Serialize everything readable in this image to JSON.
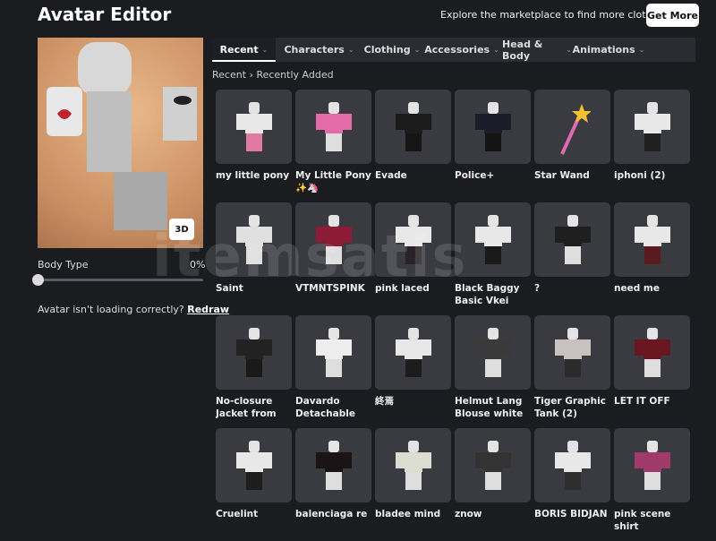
{
  "header": {
    "title": "Avatar Editor",
    "promo": "Explore the marketplace to find more clothes!",
    "get_more": "Get More"
  },
  "avatar": {
    "view_toggle": "3D",
    "body_type_label": "Body Type",
    "body_type_value": "0%",
    "body_type_fraction": 0,
    "loading_text": "Avatar isn't loading correctly?",
    "redraw": "Redraw"
  },
  "tabs": [
    {
      "label": "Recent",
      "active": true
    },
    {
      "label": "Characters"
    },
    {
      "label": "Clothing"
    },
    {
      "label": "Accessories"
    },
    {
      "label": "Head & Body"
    },
    {
      "label": "Animations"
    }
  ],
  "breadcrumb": {
    "root": "Recent",
    "sep": "›",
    "current": "Recently Added"
  },
  "watermark": "itemsatis",
  "items": [
    {
      "name": "my little pony",
      "shirt": "#e8e8e8",
      "pants": "#e07aa0"
    },
    {
      "name": "My Little Pony ✨🦄",
      "shirt": "#e56aa8",
      "pants": "#dedede"
    },
    {
      "name": "Evade",
      "shirt": "#1b1b1b",
      "pants": "#151515"
    },
    {
      "name": "Police+",
      "shirt": "#1a1c2a",
      "pants": "#141414"
    },
    {
      "name": "Star Wand",
      "shirt": null,
      "pants": null
    },
    {
      "name": "iphoni (2)",
      "shirt": "#e8e8e8",
      "pants": "#202020"
    },
    {
      "name": "Saint",
      "shirt": "#e0e0e0",
      "pants": "#dedede"
    },
    {
      "name": "VTMNTSPINK",
      "shirt": "#8d1b35",
      "pants": "#dedede"
    },
    {
      "name": "pink laced",
      "shirt": "#e8e8e8",
      "pants": "#2a2227"
    },
    {
      "name": "Black Baggy Basic Vkei Dh...",
      "shirt": "#e8e8e8",
      "pants": "#1a1a1a"
    },
    {
      "name": "?",
      "shirt": "#1e1e1e",
      "pants": "#dedede"
    },
    {
      "name": "need me",
      "shirt": "#e8e8e8",
      "pants": "#5a1a1e"
    },
    {
      "name": "No-closure Jacket from th...",
      "shirt": "#222",
      "pants": "#1a1a1a"
    },
    {
      "name": "Davardo Detachable Shirt",
      "shirt": "#eeeeee",
      "pants": "#dedede"
    },
    {
      "name": "終焉",
      "shirt": "#e8e8e8",
      "pants": "#1c1c1c"
    },
    {
      "name": "Helmut Lang Blouse white",
      "shirt": "#3a3a3a",
      "pants": "#dedede"
    },
    {
      "name": "Tiger Graphic Tank (2)",
      "shirt": "#c9c0c0",
      "pants": "#2a2a2a"
    },
    {
      "name": "LET IT OFF",
      "shirt": "#6a1620",
      "pants": "#dedede"
    },
    {
      "name": "Cruelint",
      "shirt": "#e8e8e8",
      "pants": "#1d1d1d"
    },
    {
      "name": "balenciaga re",
      "shirt": "#1a1416",
      "pants": "#dedede"
    },
    {
      "name": "bladee mind",
      "shirt": "#dcdcd0",
      "pants": "#dedede"
    },
    {
      "name": "znow",
      "shirt": "#333",
      "pants": "#dedede"
    },
    {
      "name": "BORIS BIDJAN",
      "shirt": "#e8e8e8",
      "pants": "#2e2e2e"
    },
    {
      "name": "pink scene shirt",
      "shirt": "#a03a6a",
      "pants": "#dedede"
    }
  ]
}
